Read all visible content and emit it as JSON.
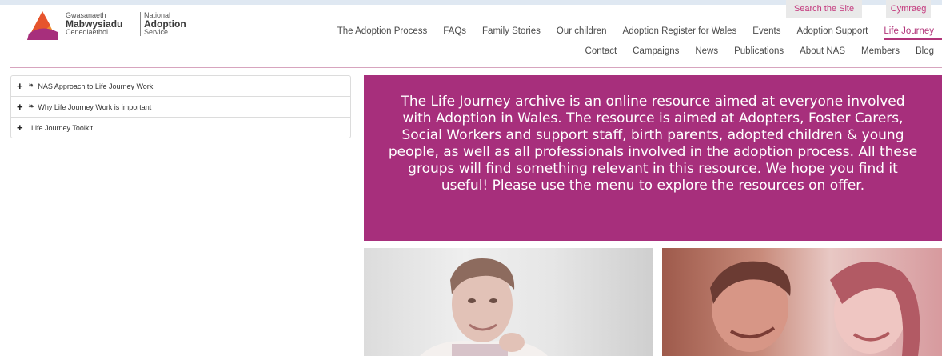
{
  "logo": {
    "welsh_line1": "Gwasanaeth",
    "welsh_line2": "Mabwysiadu",
    "welsh_line3": "Cenedlaethol",
    "english_line1": "National",
    "english_line2": "Adoption",
    "english_line3": "Service"
  },
  "utility": {
    "search_label": "Search the Site",
    "language_label": "Cymraeg"
  },
  "nav_primary": [
    {
      "label": "The Adoption Process"
    },
    {
      "label": "FAQs"
    },
    {
      "label": "Family Stories"
    },
    {
      "label": "Our children"
    },
    {
      "label": "Adoption Register for Wales"
    },
    {
      "label": "Events"
    },
    {
      "label": "Adoption Support"
    },
    {
      "label": "Life Journey"
    }
  ],
  "nav_secondary": [
    {
      "label": "Contact"
    },
    {
      "label": "Campaigns"
    },
    {
      "label": "News"
    },
    {
      "label": "Publications"
    },
    {
      "label": "About NAS"
    },
    {
      "label": "Members"
    },
    {
      "label": "Blog"
    }
  ],
  "accordion": [
    {
      "label": "NAS Approach to Life Journey Work"
    },
    {
      "label": "Why Life Journey Work is important"
    },
    {
      "label": "Life Journey Toolkit"
    }
  ],
  "banner": {
    "text": "The Life Journey archive is an online resource aimed at everyone involved with Adoption in Wales. The resource is aimed at Adopters, Foster Carers, Social Workers and support staff, birth parents, adopted children & young people, as well as all professionals involved in the adoption process. All these groups will find something relevant in this resource. We hope you find it useful! Please use the menu to explore the resources on offer."
  },
  "colors": {
    "brand_magenta": "#a72f7c",
    "active_nav": "#b2357a"
  }
}
